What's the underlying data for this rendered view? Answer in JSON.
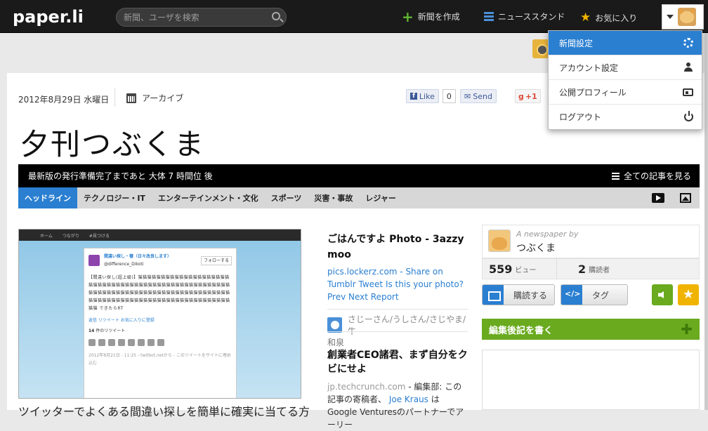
{
  "topbar": {
    "logo": "paper.li",
    "search_placeholder": "新聞、ユーザを検索",
    "create_label": "新聞を作成",
    "newsstand_label": "ニューススタンド",
    "favorites_label": "お気に入り"
  },
  "dropdown": {
    "items": [
      {
        "label": "新聞設定",
        "icon": "gear-icon"
      },
      {
        "label": "アカウント設定",
        "icon": "person-icon"
      },
      {
        "label": "公開プロフィール",
        "icon": "id-card-icon"
      },
      {
        "label": "ログアウト",
        "icon": "power-icon"
      }
    ]
  },
  "paper": {
    "date": "2012年8月29日 水曜日",
    "archive": "アーカイブ",
    "fb_like": "Like",
    "fb_count": "0",
    "send": "Send",
    "gplus": "+1",
    "title": "夕刊つぶくま",
    "next_edition": "最新版の発行準備完了まであと 大体 7 時間位 後",
    "all_articles": "全ての記事を見る"
  },
  "tabs": [
    "ヘッドライン",
    "テクノロジー・IT",
    "エンターテインメント・文化",
    "スポーツ",
    "災害・事故",
    "レジャー"
  ],
  "screenshot": {
    "nav": [
      "ホーム",
      "つながり",
      "#見つける"
    ],
    "tw_name": "間違い探し・箸（日々改良します）",
    "tw_handle": "@difference_Dikoti",
    "tw_follow": "フォローする",
    "tw_body": "【間違い探し(超上級)】猫猫猫猫猫猫猫猫猫猫猫猫猫猫猫猫猫猫猫猫猫猫猫猫猫猫猫猫猫猫猫猫猫猫猫猫猫猫猫猫猫猫猫猫猫猫猫猫猫猫猫猫猫猫猫猫猫猫猫猫猫猫猫猫猫猫猫猫猫猫猫猫猫猫猫猫猫猫猫猫猫猫猫猫猫猫猫猫猫猫猫猫猫猫猫猫猫猫猫猫猫猫猫猫猫猫猫猫猫猫猫猫猫猫猫 できたらRT",
    "tw_meta": "返信  リツイート  お気に入りに登録",
    "tw_count": "14",
    "tw_retweets": "件のリツイート",
    "tw_time": "2012年8月21日 - 11:25 - twitbot.netから - このツイートをサイトに埋め込む"
  },
  "lead_caption": "ツイッターでよくある間違い探しを簡単に確実に当てる方法。ちゃ",
  "article1": {
    "title": "ごはんですよ Photo - 3azzy moo",
    "source": "pics.lockerz.com",
    "summary": "- Share on Tumblr Tweet Is this your photo? Prev Next Report",
    "author": "さじーさん/うしさん/さじやま/牛"
  },
  "article2": {
    "category": "和泉",
    "title": "創業者CEO諸君、まず自分をクビにせよ",
    "source": "jp.techcrunch.com",
    "summary_a": "- 編集部: この記事の寄稿者、",
    "summary_link": "Joe Kraus",
    "summary_b": "はGoogle Venturesのパートナーでアーリー"
  },
  "sidebar": {
    "by_label": "A newspaper by",
    "owner": "つぶくま",
    "views": "559",
    "views_label": "ビュー",
    "subs": "2",
    "subs_label": "購読者",
    "subscribe": "購読する",
    "tag": "タグ",
    "editorial": "編集後記を書く"
  },
  "colors": {
    "accent_blue": "#2a7fd1",
    "green": "#6aaa1f",
    "gold": "#f0b400"
  }
}
